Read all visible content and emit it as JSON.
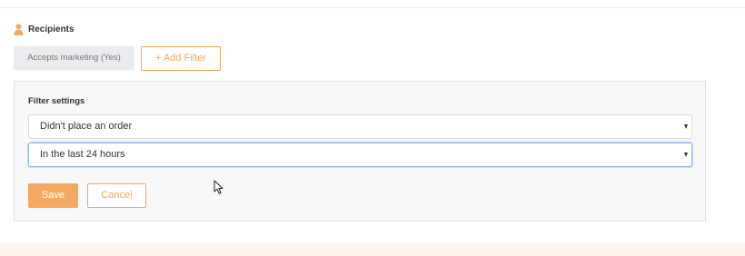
{
  "recipients": {
    "icon": "person-icon",
    "label": "Recipients",
    "chip_label": "Accepts marketing (Yes)",
    "add_filter_label": "+ Add Filter"
  },
  "filter_settings": {
    "title": "Filter settings",
    "order_condition": {
      "value": "Didn't place an order"
    },
    "time_range": {
      "value": "In the last 24 hours"
    },
    "save_label": "Save",
    "cancel_label": "Cancel"
  },
  "colors": {
    "accent": "#f5a960",
    "chip_bg": "#e9ebee",
    "panel_bg": "#f8f8f8",
    "focus_border": "#8db5f0"
  }
}
